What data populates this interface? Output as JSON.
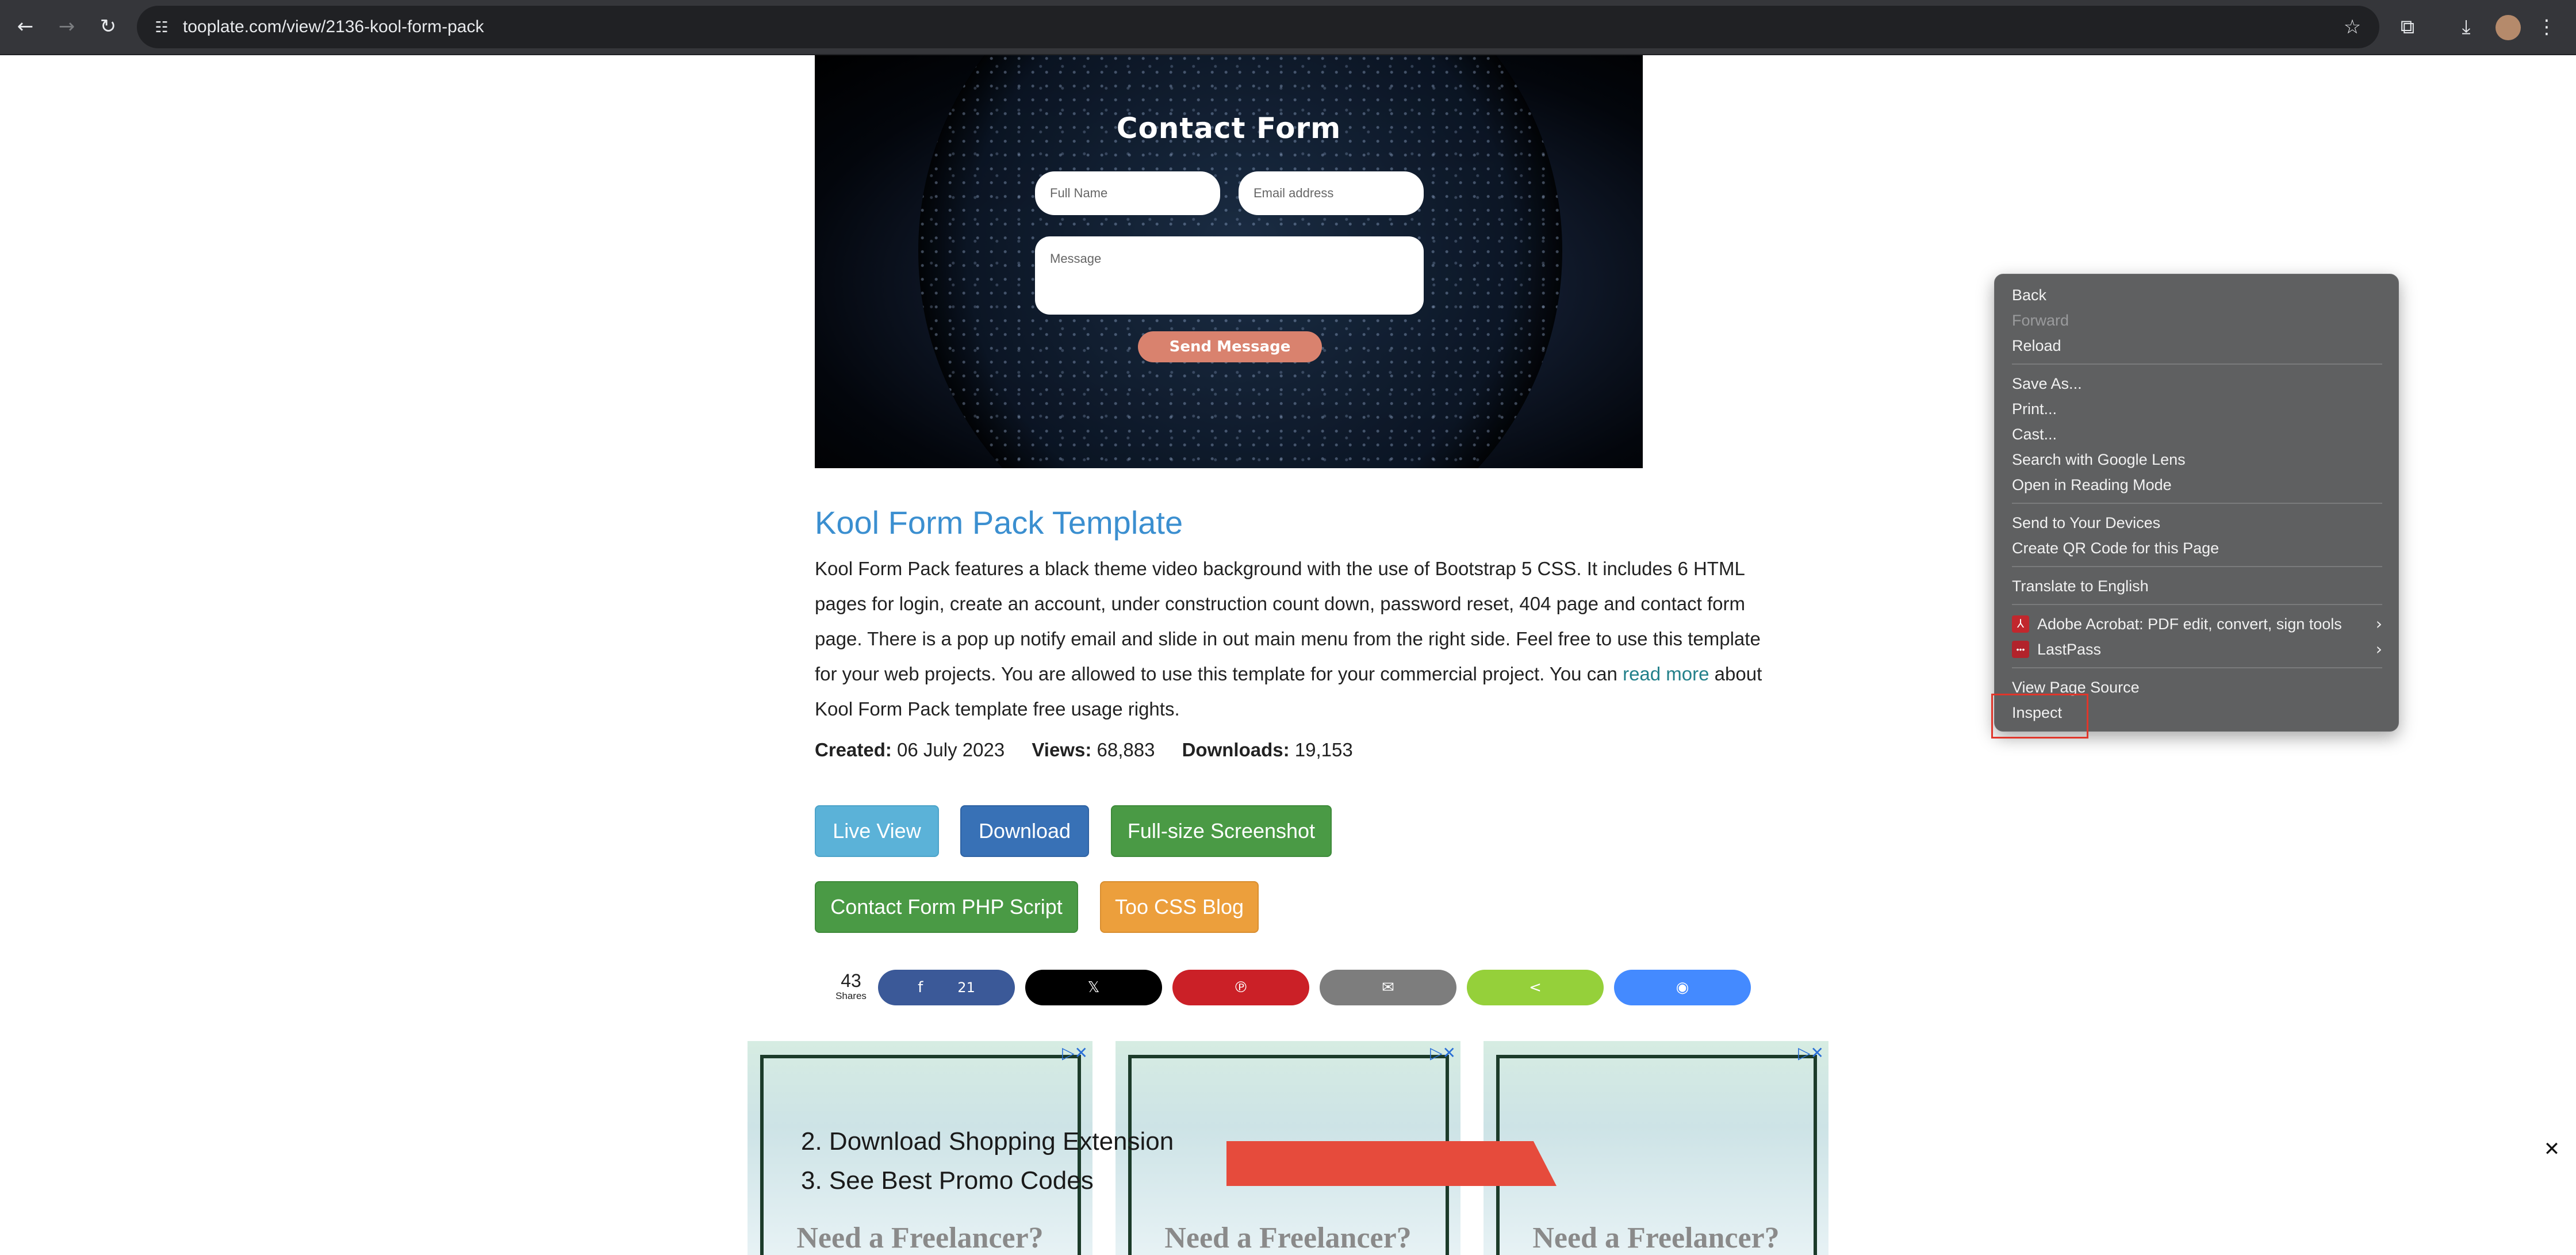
{
  "browser": {
    "url": "tooplate.com/view/2136-kool-form-pack"
  },
  "hero": {
    "form_title": "Contact Form",
    "full_name_placeholder": "Full Name",
    "email_placeholder": "Email address",
    "message_placeholder": "Message",
    "send_label": "Send Message"
  },
  "template": {
    "title": "Kool Form Pack Template",
    "desc_before_link": "Kool Form Pack features a black theme video background with the use of Bootstrap 5 CSS. It includes 6 HTML pages for login, create an account, under construction count down, password reset, 404 page and contact form page. There is a pop up notify email and slide in out main menu from the right side. Feel free to use this template for your web projects. You are allowed to use this template for your commercial project. You can ",
    "link_text": "read more",
    "desc_after_link": " about Kool Form Pack template free usage rights.",
    "created_label": "Created:",
    "created_value": "06 July 2023",
    "views_label": "Views:",
    "views_value": "68,883",
    "downloads_label": "Downloads:",
    "downloads_value": "19,153"
  },
  "buttons": {
    "live_view": "Live View",
    "download": "Download",
    "full_size": "Full-size Screenshot",
    "php_script": "Contact Form PHP Script",
    "css_blog": "Too CSS Blog"
  },
  "share": {
    "count": "43",
    "label": "Shares",
    "facebook_count": "21",
    "facebook_icon": "f",
    "x_icon": "𝕏",
    "pinterest_icon": "℗",
    "email_icon": "✉",
    "share_icon": "<",
    "messenger_icon": "◉"
  },
  "ads": {
    "headline": "Need a Freelancer?",
    "line1": "2. Download Shopping Extension",
    "line2": "3. See Best Promo Codes"
  },
  "context_menu": {
    "items": [
      {
        "label": "Back"
      },
      {
        "label": "Forward"
      },
      {
        "label": "Reload"
      },
      {
        "label": "Save As..."
      },
      {
        "label": "Print..."
      },
      {
        "label": "Cast..."
      },
      {
        "label": "Search with Google Lens"
      },
      {
        "label": "Open in Reading Mode"
      },
      {
        "label": "Send to Your Devices"
      },
      {
        "label": "Create QR Code for this Page"
      },
      {
        "label": "Translate to English"
      },
      {
        "label": "Adobe Acrobat: PDF edit, convert, sign tools"
      },
      {
        "label": "LastPass"
      },
      {
        "label": "View Page Source"
      },
      {
        "label": "Inspect"
      }
    ]
  },
  "colors": {
    "link_blue": "#3b8fd0",
    "read_more": "#22808a",
    "highlight_red": "#e0362b"
  }
}
